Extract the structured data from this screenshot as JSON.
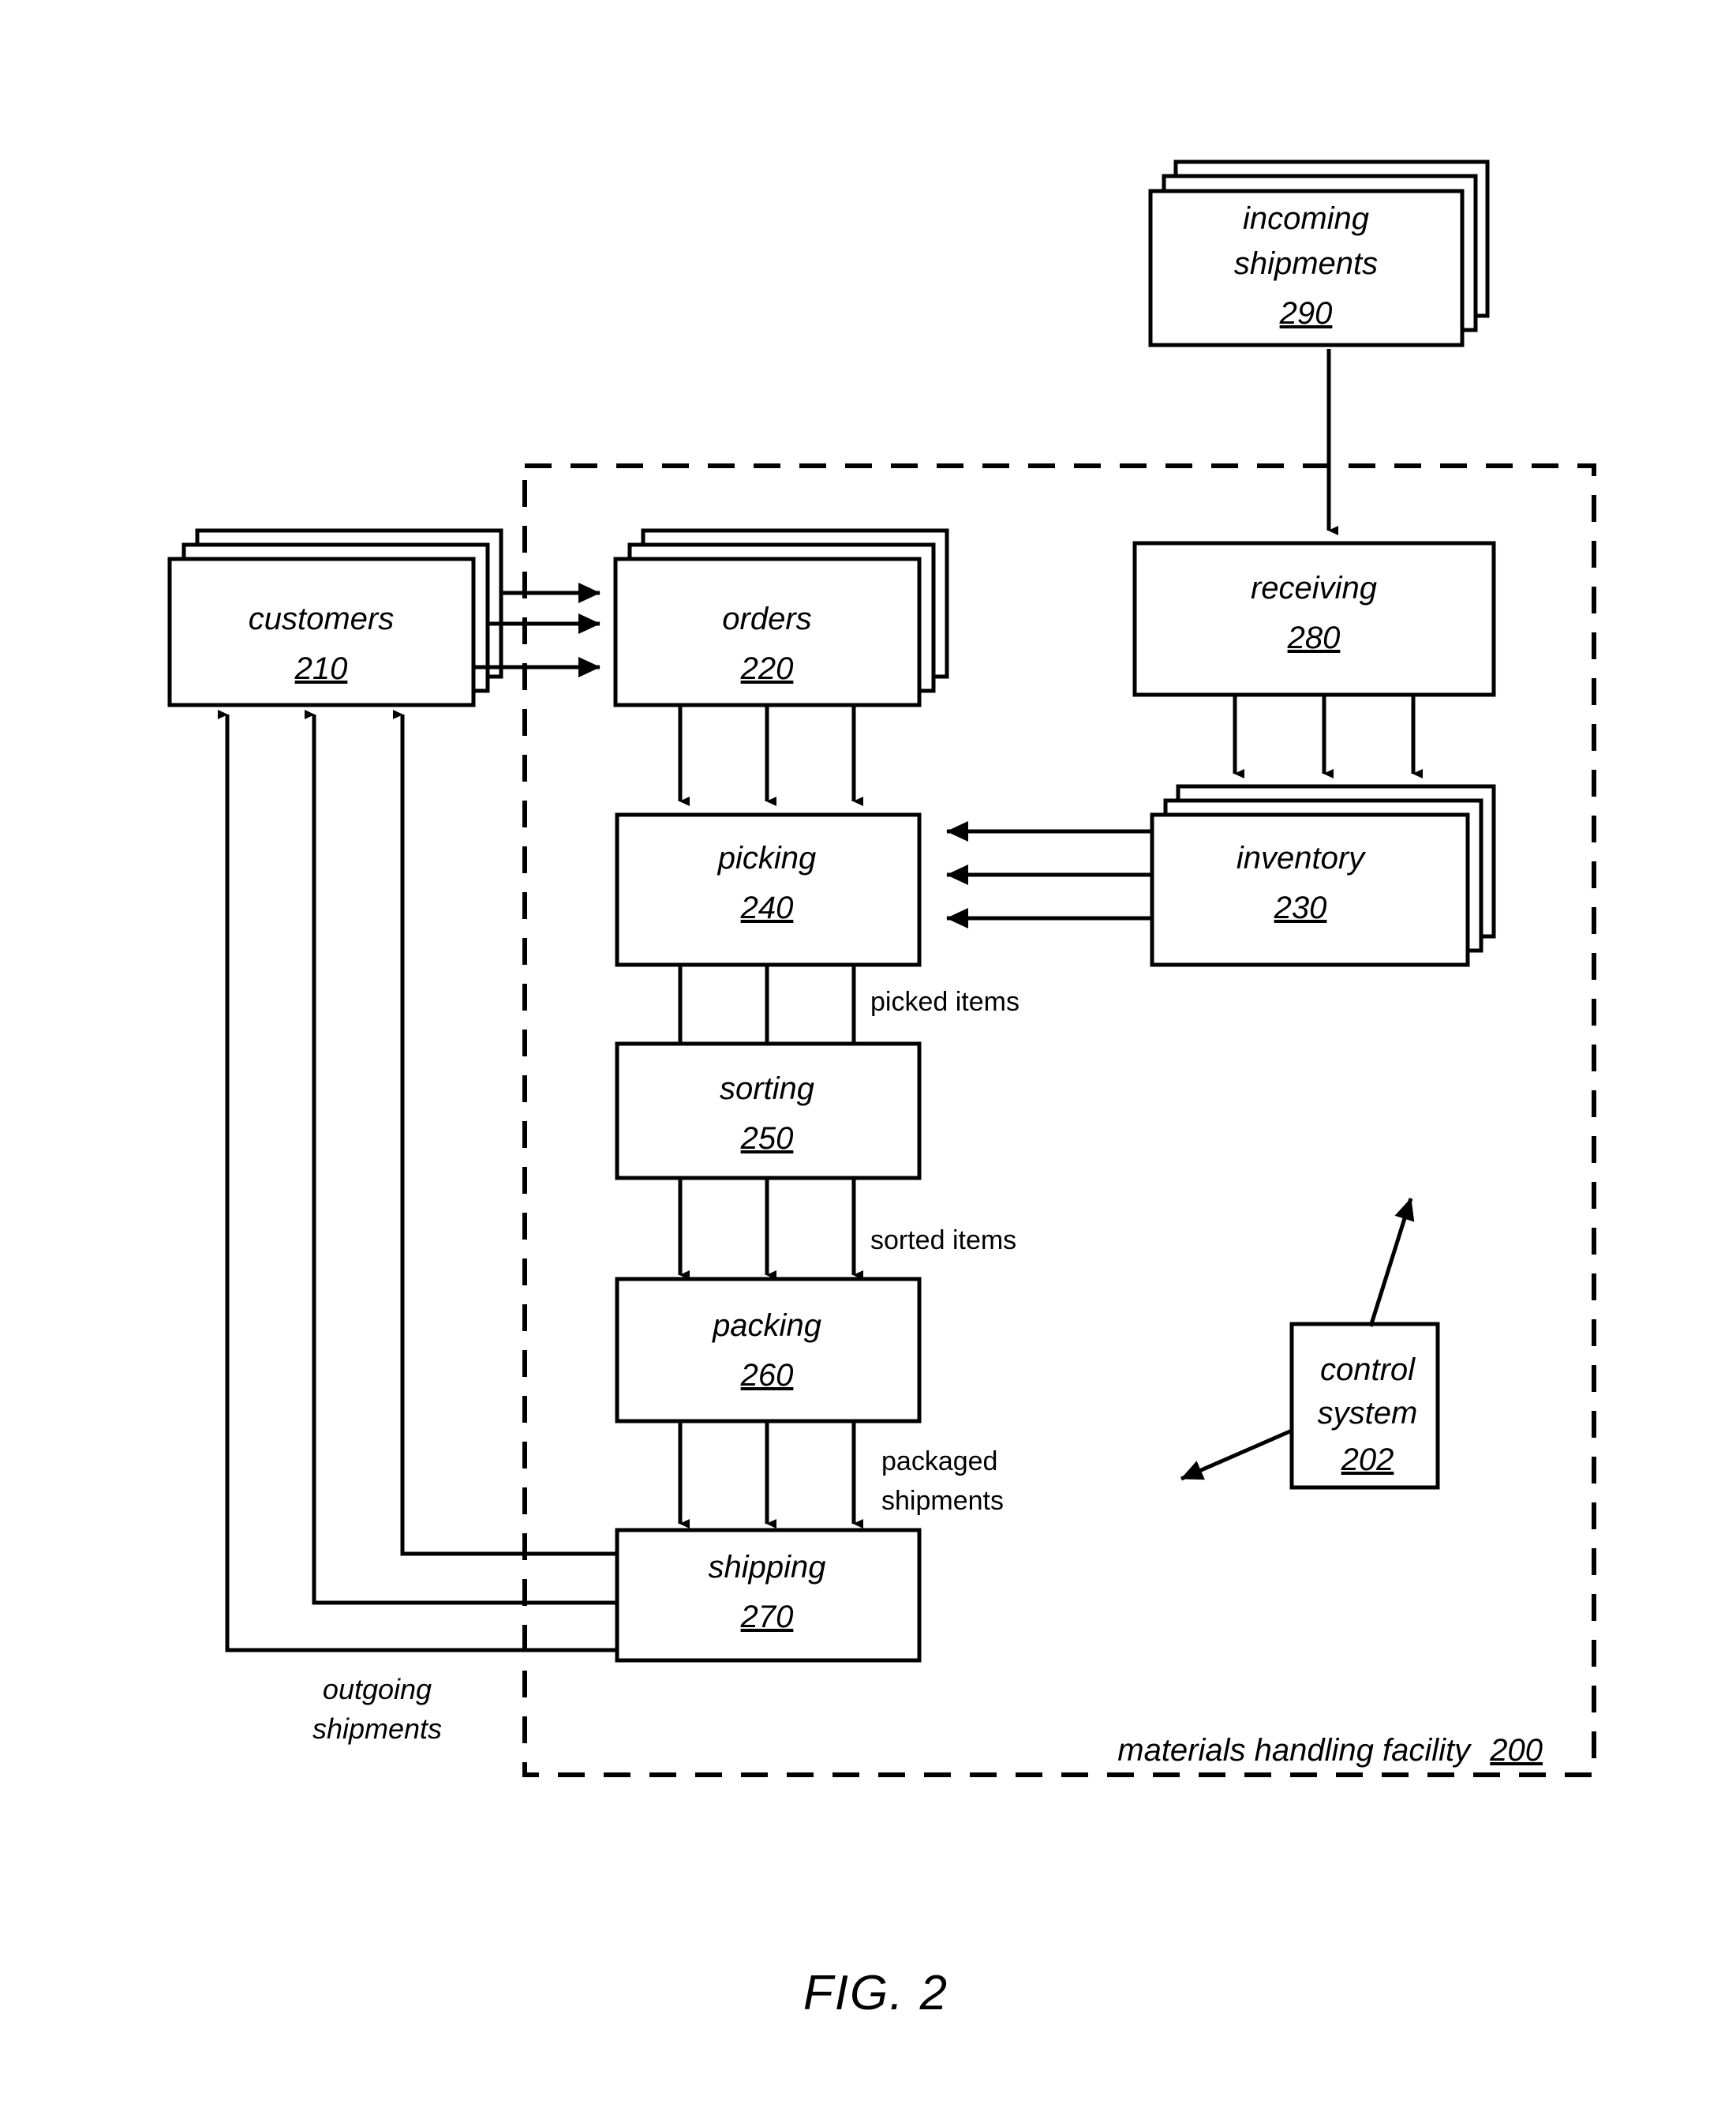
{
  "figure": {
    "caption": "FIG. 2",
    "facility_boundary_label": "materials handling facility",
    "facility_boundary_number": "200"
  },
  "nodes": {
    "incoming_shipments": {
      "label": "incoming",
      "label2": "shipments",
      "number": "290",
      "stacked": true
    },
    "customers": {
      "label": "customers",
      "number": "210",
      "stacked": true
    },
    "orders": {
      "label": "orders",
      "number": "220",
      "stacked": true
    },
    "receiving": {
      "label": "receiving",
      "number": "280",
      "stacked": false
    },
    "inventory": {
      "label": "inventory",
      "number": "230",
      "stacked": true
    },
    "picking": {
      "label": "picking",
      "number": "240",
      "stacked": false
    },
    "sorting": {
      "label": "sorting",
      "number": "250",
      "stacked": false
    },
    "packing": {
      "label": "packing",
      "number": "260",
      "stacked": false
    },
    "shipping": {
      "label": "shipping",
      "number": "270",
      "stacked": false
    },
    "control_system": {
      "label": "control",
      "label2": "system",
      "number": "202",
      "stacked": false
    }
  },
  "edge_labels": {
    "picked_items": "picked items",
    "sorted_items": "sorted items",
    "packaged": "packaged",
    "packaged_shipments": "shipments",
    "outgoing": "outgoing",
    "outgoing_shipments": "shipments"
  },
  "colors": {
    "stroke": "#000000",
    "fill": "#ffffff",
    "background": "#ffffff"
  }
}
